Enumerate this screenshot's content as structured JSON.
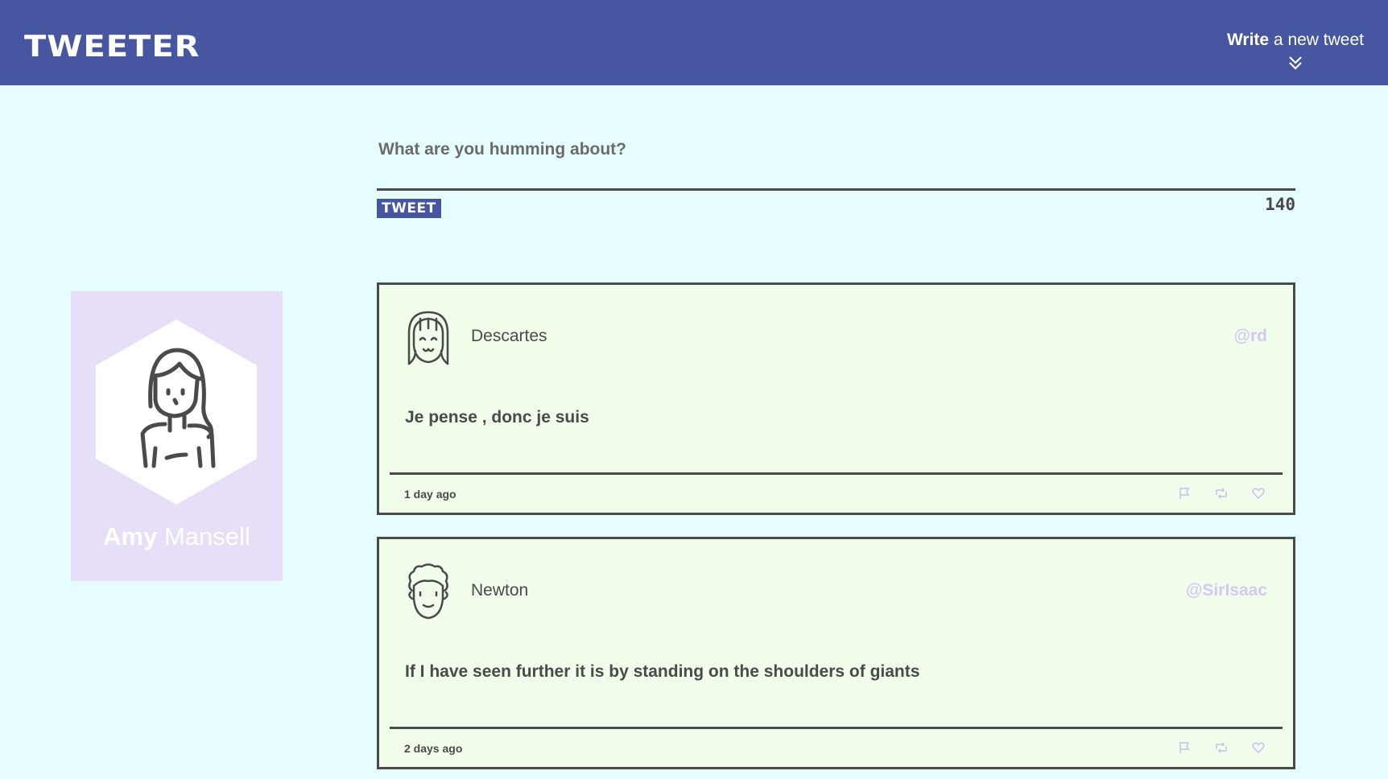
{
  "header": {
    "brand": "TWEETER",
    "compose_bold": "Write",
    "compose_rest": " a new tweet",
    "toggle_icon": "double-chevron-down"
  },
  "composer": {
    "placeholder": "What are you humming about?",
    "button_label": "TWEET",
    "char_count": "140"
  },
  "profile": {
    "first_name": "Amy",
    "last_name": " Mansell",
    "avatar_icon": "woman-avatar"
  },
  "tweets": [
    {
      "author": "Descartes",
      "handle": "@rd",
      "content": "Je pense , donc je suis",
      "time": "1 day ago",
      "avatar_icon": "bangs-face-avatar"
    },
    {
      "author": "Newton",
      "handle": "@SirIsaac",
      "content": "If I have seen further it is by standing on the shoulders of giants",
      "time": "2 days ago",
      "avatar_icon": "curly-hair-avatar"
    }
  ],
  "actions": [
    "flag-icon",
    "retweet-icon",
    "heart-icon"
  ],
  "colors": {
    "nav": "#4656a0",
    "page_bg": "#e6fdfd",
    "tweet_bg": "#f0fdea",
    "profile_bg": "#e6dff7",
    "handle": "#d5c9f2",
    "text": "#4a4a4a"
  }
}
